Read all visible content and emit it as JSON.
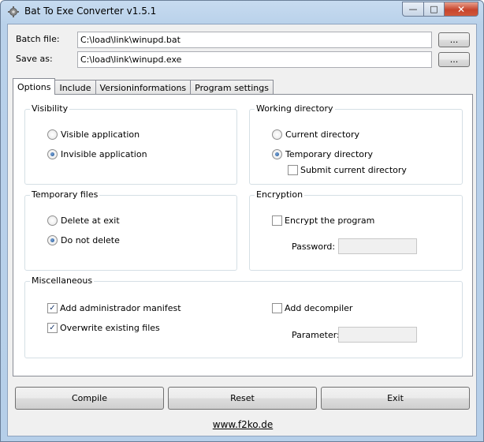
{
  "window": {
    "title": "Bat To Exe Converter v1.5.1",
    "min_label": "—",
    "max_label": "□",
    "close_label": "✕"
  },
  "files": {
    "batch_label": "Batch file:",
    "batch_value": "C:\\load\\link\\winupd.bat",
    "batch_browse": "...",
    "save_label": "Save as:",
    "save_value": "C:\\load\\link\\winupd.exe",
    "save_browse": "..."
  },
  "tabs": [
    {
      "label": "Options",
      "active": true
    },
    {
      "label": "Include"
    },
    {
      "label": "Versioninformations"
    },
    {
      "label": "Program settings"
    }
  ],
  "visibility": {
    "title": "Visibility",
    "visible_label": "Visible application",
    "invisible_label": "Invisible application",
    "selected": "invisible"
  },
  "working_directory": {
    "title": "Working directory",
    "current_label": "Current directory",
    "temporary_label": "Temporary directory",
    "submit_label": "Submit current directory",
    "selected": "temporary",
    "submit_checked": false
  },
  "temporary_files": {
    "title": "Temporary files",
    "delete_label": "Delete at exit",
    "nodelete_label": "Do not delete",
    "selected": "nodelete"
  },
  "encryption": {
    "title": "Encryption",
    "encrypt_label": "Encrypt the program",
    "encrypt_checked": false,
    "password_label": "Password:"
  },
  "misc": {
    "title": "Miscellaneous",
    "admin_label": "Add administrador manifest",
    "admin_checked": true,
    "overwrite_label": "Overwrite existing files",
    "overwrite_checked": true,
    "decompiler_label": "Add decompiler",
    "decompiler_checked": false,
    "parameter_label": "Parameter:"
  },
  "actions": {
    "compile": "Compile",
    "reset": "Reset",
    "exit": "Exit"
  },
  "footer": {
    "link": "www.f2ko.de"
  }
}
